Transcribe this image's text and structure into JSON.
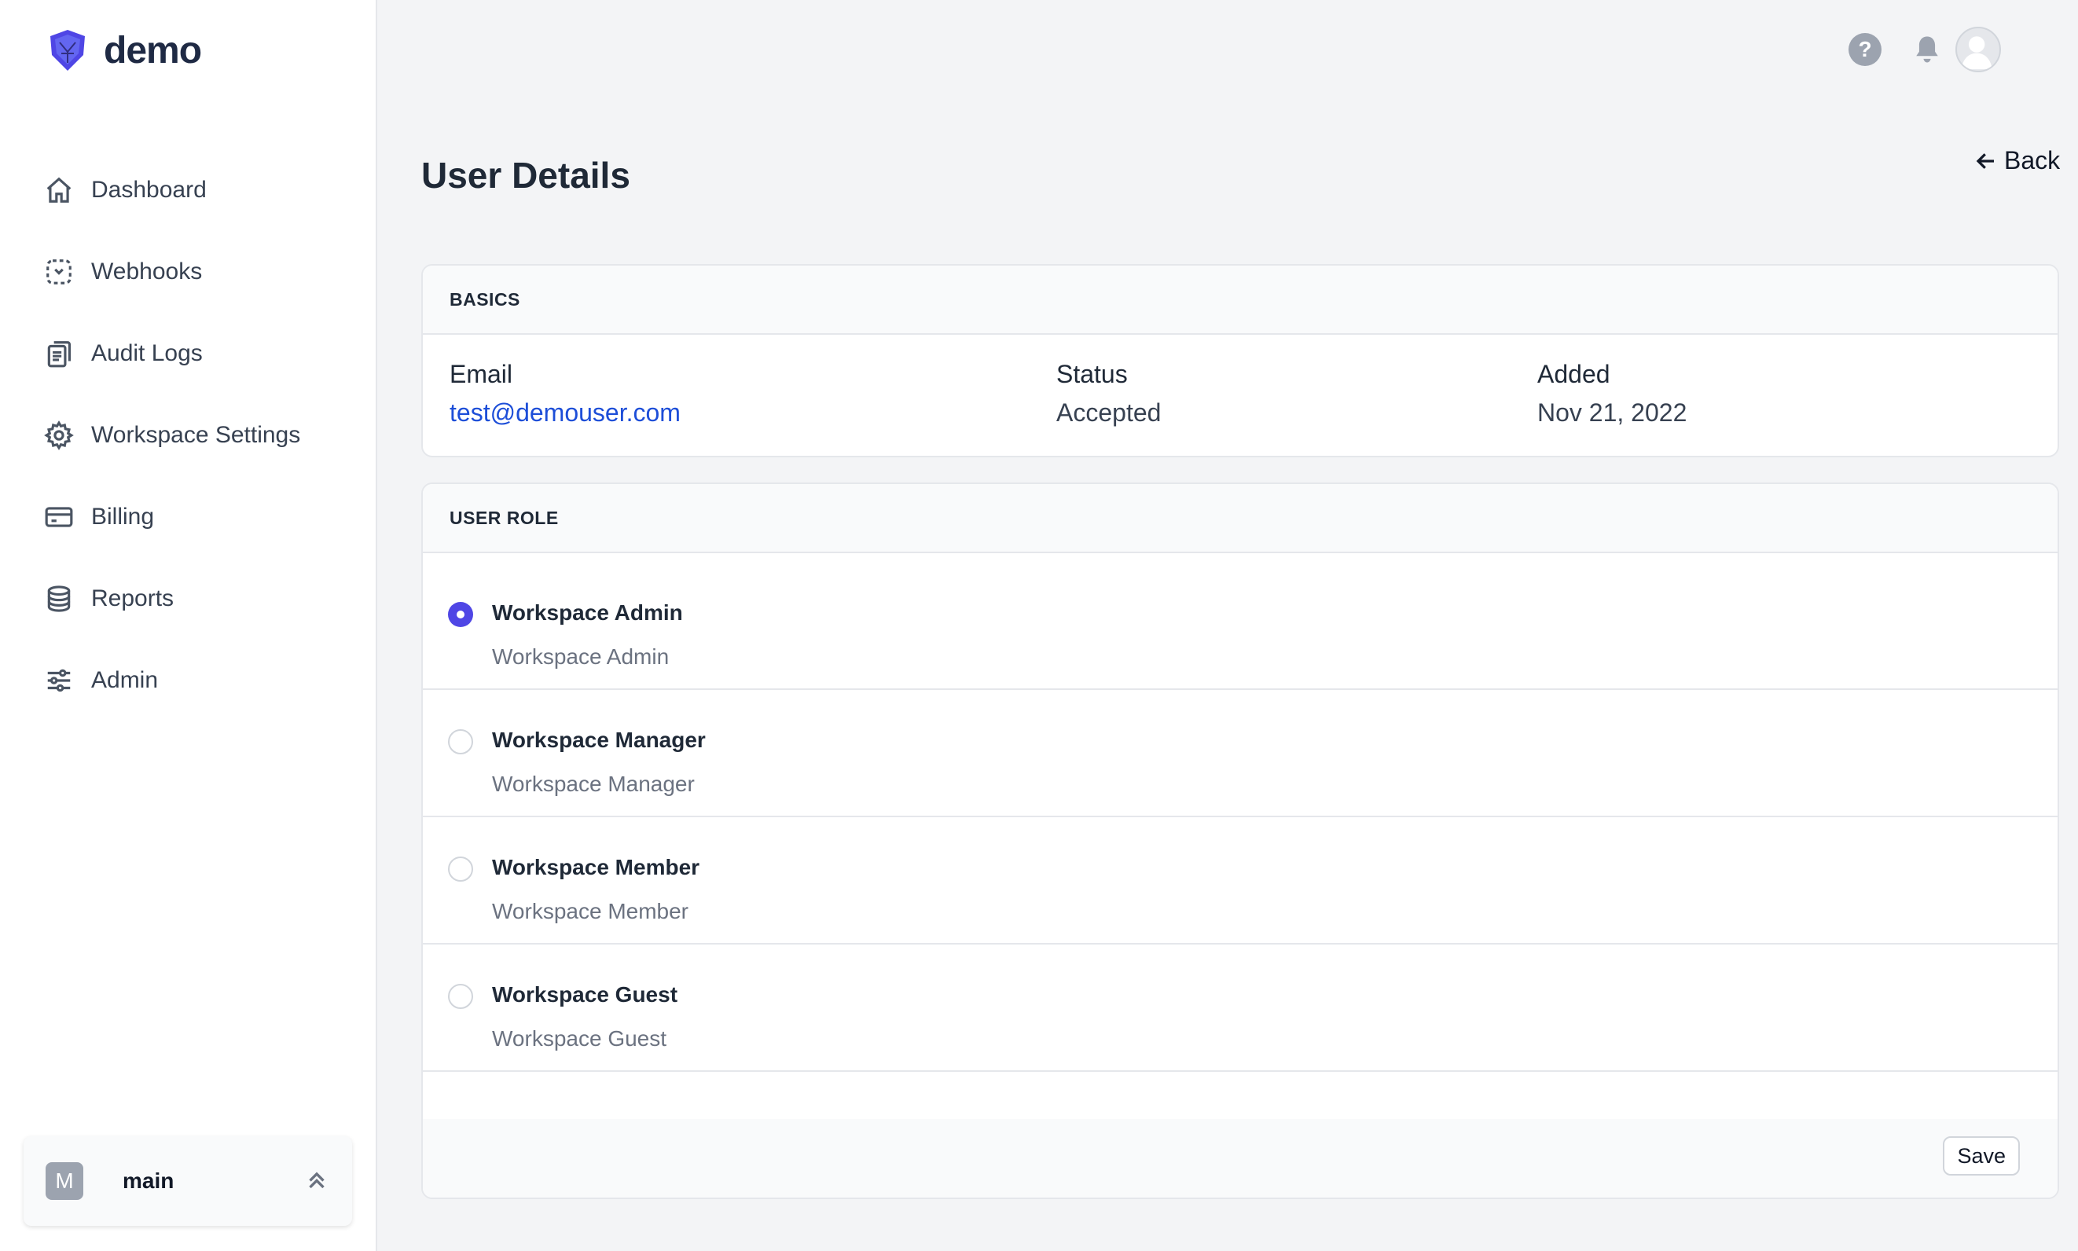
{
  "brand": {
    "name": "demo"
  },
  "sidebar": {
    "items": [
      {
        "label": "Dashboard",
        "icon": "home-icon"
      },
      {
        "label": "Webhooks",
        "icon": "webhook-icon"
      },
      {
        "label": "Audit Logs",
        "icon": "clipboard-icon"
      },
      {
        "label": "Workspace Settings",
        "icon": "gear-icon"
      },
      {
        "label": "Billing",
        "icon": "credit-card-icon"
      },
      {
        "label": "Reports",
        "icon": "database-icon"
      },
      {
        "label": "Admin",
        "icon": "sliders-icon"
      }
    ],
    "workspace": {
      "initial": "M",
      "name": "main"
    }
  },
  "header": {
    "help": "?"
  },
  "page": {
    "title": "User Details",
    "back_label": "Back"
  },
  "basics": {
    "header": "BASICS",
    "email_label": "Email",
    "email_value": "test@demouser.com",
    "status_label": "Status",
    "status_value": "Accepted",
    "added_label": "Added",
    "added_value": "Nov 21, 2022"
  },
  "roles": {
    "header": "USER ROLE",
    "options": [
      {
        "title": "Workspace Admin",
        "desc": "Workspace Admin",
        "selected": true
      },
      {
        "title": "Workspace Manager",
        "desc": "Workspace Manager",
        "selected": false
      },
      {
        "title": "Workspace Member",
        "desc": "Workspace Member",
        "selected": false
      },
      {
        "title": "Workspace Guest",
        "desc": "Workspace Guest",
        "selected": false
      }
    ],
    "save_label": "Save"
  },
  "colors": {
    "accent": "#4f46e5",
    "link": "#1d4ed8",
    "brand": "#4f46e5"
  }
}
